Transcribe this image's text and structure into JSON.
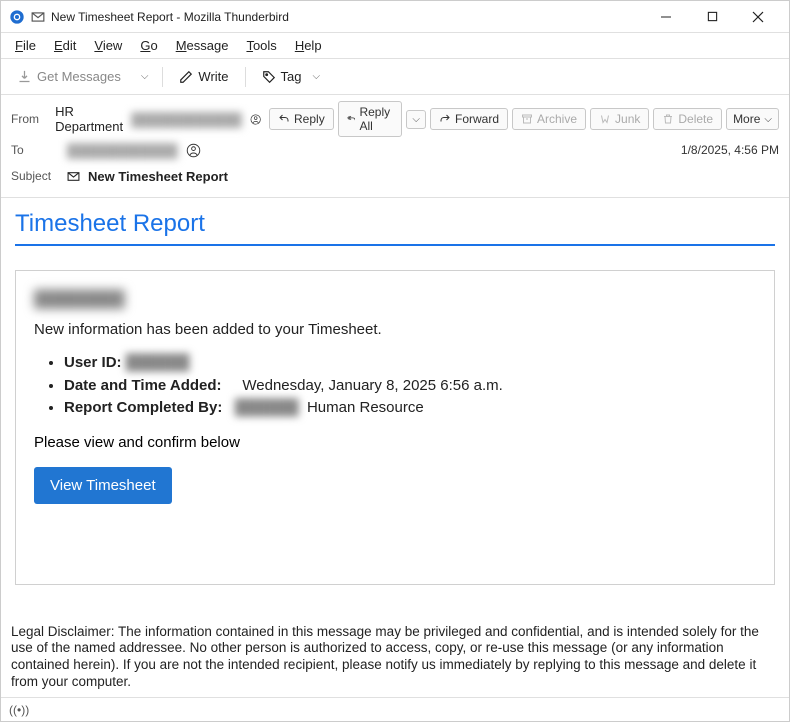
{
  "window": {
    "title": "New Timesheet Report - Mozilla Thunderbird"
  },
  "menubar": {
    "file": "File",
    "edit": "Edit",
    "view": "View",
    "go": "Go",
    "message": "Message",
    "tools": "Tools",
    "help": "Help"
  },
  "toolbar": {
    "get_messages": "Get Messages",
    "write": "Write",
    "tag": "Tag"
  },
  "headers": {
    "from_label": "From",
    "to_label": "To",
    "subject_label": "Subject",
    "from_value": "HR Department",
    "from_hidden": "████████████",
    "to_hidden": "████████████",
    "subject_value": "New Timesheet Report",
    "timestamp": "1/8/2025, 4:56 PM"
  },
  "actions": {
    "reply": "Reply",
    "reply_all": "Reply All",
    "forward": "Forward",
    "archive": "Archive",
    "junk": "Junk",
    "delete": "Delete",
    "more": "More"
  },
  "email_body": {
    "title": "Timesheet Report",
    "recipient_name": "████████",
    "intro": "New information has been added to your Timesheet.",
    "user_id_label": "User ID:",
    "user_id_value": "██████",
    "datetime_label": "Date and Time Added:",
    "datetime_value": "Wednesday, January 8, 2025 6:56 a.m.",
    "completed_label": "Report Completed By:",
    "completed_hidden": "██████",
    "completed_value": "Human Resource",
    "confirm_text": "Please view and confirm below",
    "button_label": "View Timesheet",
    "disclaimer": "Legal Disclaimer: The information contained in this message may be privileged and confidential, and is intended solely for the use of the named addressee. No other person is authorized to access, copy, or re-use this message (or any information contained herein). If you are not the intended recipient, please notify us immediately by replying to this message and delete it from your computer."
  }
}
